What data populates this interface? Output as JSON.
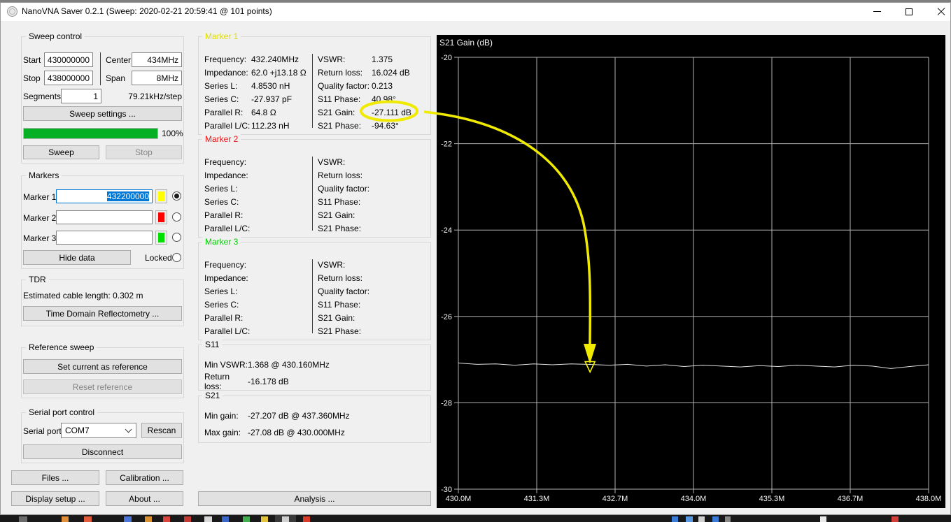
{
  "window": {
    "title": "NanoVNA Saver 0.2.1 (Sweep: 2020-02-21 20:59:41 @ 101 points)"
  },
  "sweep_control": {
    "title": "Sweep control",
    "start_label": "Start",
    "start_value": "430000000",
    "center_label": "Center",
    "center_value": "434MHz",
    "stop_label": "Stop",
    "stop_value": "438000000",
    "span_label": "Span",
    "span_value": "8MHz",
    "segments_label": "Segments",
    "segments_value": "1",
    "step_info": "79.21kHz/step",
    "sweep_settings_button": "Sweep settings ...",
    "progress_percent": "100%",
    "sweep_button": "Sweep",
    "stop_button": "Stop"
  },
  "markers_panel": {
    "title": "Markers",
    "marker1_label": "Marker 1",
    "marker1_value": "432200000",
    "marker1_color": "#ffff00",
    "marker2_label": "Marker 2",
    "marker2_value": "",
    "marker2_color": "#ff0000",
    "marker3_label": "Marker 3",
    "marker3_value": "",
    "marker3_color": "#00e000",
    "hide_data_button": "Hide data",
    "locked_label": "Locked"
  },
  "tdr": {
    "title": "TDR",
    "cable_length_text": "Estimated cable length:  0.302 m",
    "button": "Time Domain Reflectometry ..."
  },
  "reference_sweep": {
    "title": "Reference sweep",
    "set_button": "Set current as reference",
    "reset_button": "Reset reference"
  },
  "serial": {
    "title": "Serial port control",
    "port_label": "Serial port",
    "port_value": "COM7",
    "rescan_button": "Rescan",
    "disconnect_button": "Disconnect"
  },
  "bottom_buttons": {
    "files": "Files ...",
    "calibration": "Calibration ...",
    "display_setup": "Display setup ...",
    "about": "About ...",
    "analysis": "Analysis ..."
  },
  "marker_details": [
    {
      "title": "Marker 1",
      "title_color": "#dede00",
      "left": [
        {
          "label": "Frequency:",
          "value": "432.240MHz"
        },
        {
          "label": "Impedance:",
          "value": "62.0 +j13.18 Ω"
        },
        {
          "label": "Series L:",
          "value": "4.8530 nH"
        },
        {
          "label": "Series C:",
          "value": "-27.937 pF"
        },
        {
          "label": "Parallel R:",
          "value": "64.8 Ω"
        },
        {
          "label": "Parallel L/C:",
          "value": "112.23 nH"
        }
      ],
      "right": [
        {
          "label": "VSWR:",
          "value": "1.375"
        },
        {
          "label": "Return loss:",
          "value": "16.024 dB"
        },
        {
          "label": "Quality factor:",
          "value": "0.213"
        },
        {
          "label": "S11 Phase:",
          "value": "40.98°"
        },
        {
          "label": "S21 Gain:",
          "value": "-27.111 dB"
        },
        {
          "label": "S21 Phase:",
          "value": "-94.63°"
        }
      ]
    },
    {
      "title": "Marker 2",
      "title_color": "#e81414",
      "left": [
        {
          "label": "Frequency:",
          "value": ""
        },
        {
          "label": "Impedance:",
          "value": ""
        },
        {
          "label": "Series L:",
          "value": ""
        },
        {
          "label": "Series C:",
          "value": ""
        },
        {
          "label": "Parallel R:",
          "value": ""
        },
        {
          "label": "Parallel L/C:",
          "value": ""
        }
      ],
      "right": [
        {
          "label": "VSWR:",
          "value": ""
        },
        {
          "label": "Return loss:",
          "value": ""
        },
        {
          "label": "Quality factor:",
          "value": ""
        },
        {
          "label": "S11 Phase:",
          "value": ""
        },
        {
          "label": "S21 Gain:",
          "value": ""
        },
        {
          "label": "S21 Phase:",
          "value": ""
        }
      ]
    },
    {
      "title": "Marker 3",
      "title_color": "#00cd00",
      "left": [
        {
          "label": "Frequency:",
          "value": ""
        },
        {
          "label": "Impedance:",
          "value": ""
        },
        {
          "label": "Series L:",
          "value": ""
        },
        {
          "label": "Series C:",
          "value": ""
        },
        {
          "label": "Parallel R:",
          "value": ""
        },
        {
          "label": "Parallel L/C:",
          "value": ""
        }
      ],
      "right": [
        {
          "label": "VSWR:",
          "value": ""
        },
        {
          "label": "Return loss:",
          "value": ""
        },
        {
          "label": "Quality factor:",
          "value": ""
        },
        {
          "label": "S11 Phase:",
          "value": ""
        },
        {
          "label": "S21 Gain:",
          "value": ""
        },
        {
          "label": "S21 Phase:",
          "value": ""
        }
      ]
    }
  ],
  "s11_panel": {
    "title": "S11",
    "row1_label": "Min VSWR:",
    "row1_value": "1.368 @ 430.160MHz",
    "row2_label": "Return loss:",
    "row2_value": "-16.178 dB"
  },
  "s21_panel": {
    "title": "S21",
    "row1_label": "Min gain:",
    "row1_value": "-27.207 dB @ 437.360MHz",
    "row2_label": "Max gain:",
    "row2_value": "-27.08 dB @ 430.000MHz"
  },
  "annotation": {
    "color": "#f0ea00",
    "highlighted_value": "-27.111 dB"
  },
  "chart_data": {
    "type": "line",
    "title": "S21 Gain (dB)",
    "x_range_mhz": [
      430,
      438
    ],
    "ylim": [
      -30,
      -20
    ],
    "y_ticks": [
      -20,
      -22,
      -24,
      -26,
      -28,
      -30
    ],
    "xlabel_ticks": [
      "430.0M",
      "431.3M",
      "432.7M",
      "434.0M",
      "435.3M",
      "436.7M",
      "438.0M"
    ],
    "grid": true,
    "grid_color": "#b2b2b2",
    "bg_color": "#000000",
    "trace_color": "#e2e2e2",
    "series": [
      {
        "name": "S21 Gain",
        "points": [
          [
            430.0,
            -27.08
          ],
          [
            430.32,
            -27.11
          ],
          [
            430.64,
            -27.1
          ],
          [
            430.96,
            -27.13
          ],
          [
            431.28,
            -27.1
          ],
          [
            431.6,
            -27.12
          ],
          [
            431.92,
            -27.1
          ],
          [
            432.24,
            -27.111
          ],
          [
            432.56,
            -27.13
          ],
          [
            432.88,
            -27.11
          ],
          [
            433.2,
            -27.15
          ],
          [
            433.52,
            -27.12
          ],
          [
            433.84,
            -27.16
          ],
          [
            434.16,
            -27.13
          ],
          [
            434.48,
            -27.15
          ],
          [
            434.8,
            -27.17
          ],
          [
            435.12,
            -27.14
          ],
          [
            435.44,
            -27.16
          ],
          [
            435.76,
            -27.13
          ],
          [
            436.08,
            -27.15
          ],
          [
            436.4,
            -27.17
          ],
          [
            436.72,
            -27.13
          ],
          [
            437.04,
            -27.15
          ],
          [
            437.36,
            -27.207
          ],
          [
            437.68,
            -27.16
          ],
          [
            438.0,
            -27.12
          ]
        ]
      }
    ],
    "marker": {
      "label": "Marker 1",
      "freq_mhz": 432.24,
      "gain_db": -27.111,
      "color": "#ffff00"
    }
  }
}
